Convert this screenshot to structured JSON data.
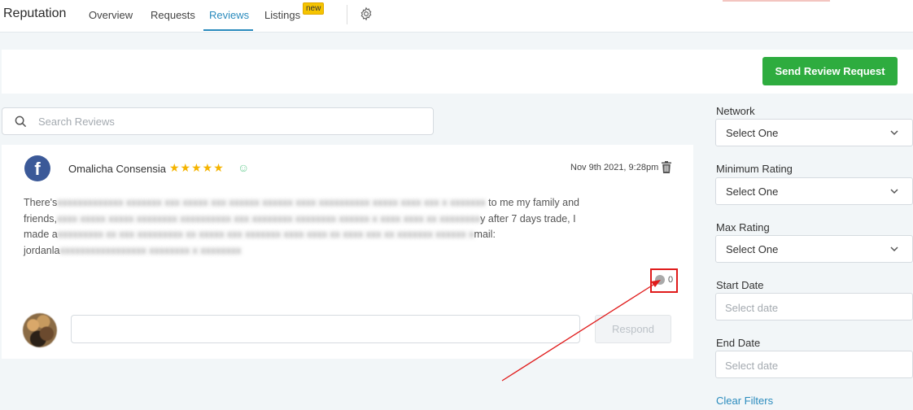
{
  "header": {
    "app_title": "Reputation",
    "tabs": [
      {
        "label": "Overview",
        "active": false
      },
      {
        "label": "Requests",
        "active": false
      },
      {
        "label": "Reviews",
        "active": true
      },
      {
        "label": "Listings",
        "active": false
      }
    ],
    "listings_badge": "new",
    "settings_icon": "gear-icon"
  },
  "actions": {
    "send_review_request": "Send Review Request",
    "send_button_color": "#2eac3f"
  },
  "search": {
    "placeholder": "Search Reviews",
    "value": ""
  },
  "review": {
    "network_icon": "facebook-icon",
    "network_glyph": "f",
    "reviewer_name": "Omalicha Consensia",
    "rating": 5,
    "stars": "★★★★★",
    "sentiment_icon": "smiley-icon",
    "sentiment_glyph": "☺",
    "date": "Nov 9th 2021, 9:28pm",
    "text_line1_start": "There's",
    "text_line1_end": "to me my family and",
    "text_line2_start": "friends,",
    "text_line2_end": "y after 7 days trade, I",
    "text_line3_start": "made a",
    "text_line3_end": "mail:",
    "text_line4_start": "jordanla",
    "comment_count": "0",
    "respond_label": "Respond",
    "respond_value": ""
  },
  "filters": {
    "network_label": "Network",
    "network_value": "Select One",
    "min_rating_label": "Minimum Rating",
    "min_rating_value": "Select One",
    "max_rating_label": "Max Rating",
    "max_rating_value": "Select One",
    "start_date_label": "Start Date",
    "start_date_placeholder": "Select date",
    "end_date_label": "End Date",
    "end_date_placeholder": "Select date",
    "clear_filters": "Clear Filters"
  },
  "colors": {
    "accent": "#2a8bbd",
    "annotation_red": "#e01b1b",
    "star": "#f5b400",
    "facebook": "#3b5998"
  }
}
